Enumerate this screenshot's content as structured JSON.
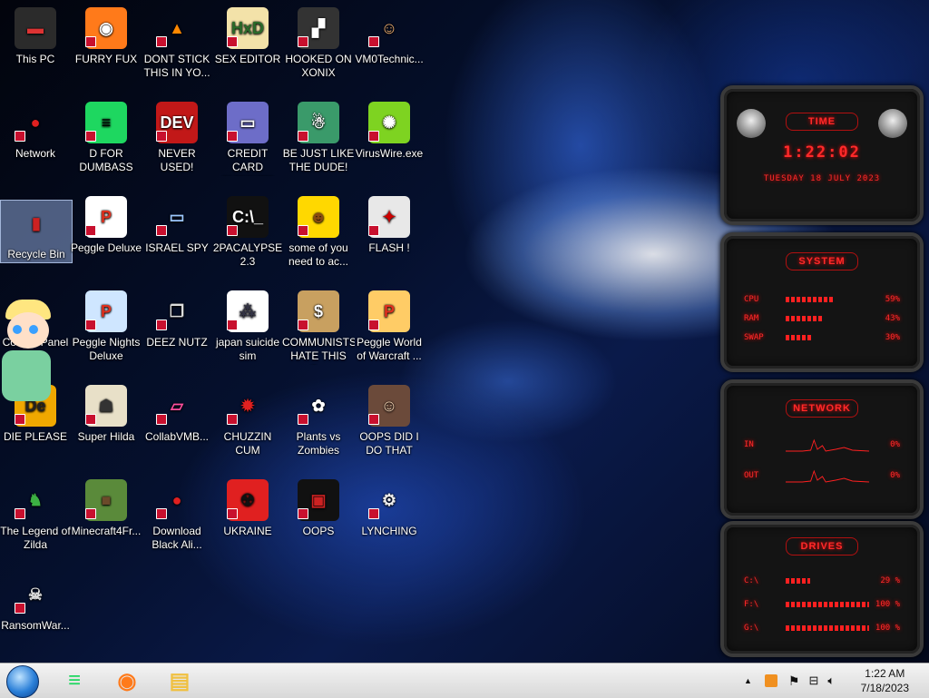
{
  "desktop_icons": [
    {
      "label": "This PC",
      "glyph": "▬",
      "bg": "#2b2b2b",
      "fg": "#d33"
    },
    {
      "label": "FURRY FUX",
      "glyph": "◉",
      "bg": "#ff7a1a",
      "fg": "#fff"
    },
    {
      "label": "DONT STICK THIS IN YO...",
      "glyph": "▲",
      "bg": "transparent",
      "fg": "#ff8800"
    },
    {
      "label": "SEX EDITOR",
      "glyph": "HxD",
      "bg": "#f3e2a9",
      "fg": "#2a6b2a"
    },
    {
      "label": "HOOKED ON XONIX",
      "glyph": "▞",
      "bg": "#333",
      "fg": "#fff"
    },
    {
      "label": "VM0Technic...",
      "glyph": "☺",
      "bg": "transparent",
      "fg": "#f0b070"
    },
    {
      "label": "Network",
      "glyph": "●",
      "bg": "transparent",
      "fg": "#e02020"
    },
    {
      "label": "D FOR DUMBASS",
      "glyph": "≡",
      "bg": "#1ed760",
      "fg": "#000"
    },
    {
      "label": "NEVER USED!",
      "glyph": "DEV",
      "bg": "#c21818",
      "fg": "#fff"
    },
    {
      "label": "CREDIT CARD CHECKER",
      "glyph": "▭",
      "bg": "#6d6dc8",
      "fg": "#fff"
    },
    {
      "label": "BE JUST LIKE THE DUDE!",
      "glyph": "☃",
      "bg": "#3a9a6a",
      "fg": "#fff"
    },
    {
      "label": "VirusWire.exe",
      "glyph": "✺",
      "bg": "#7ed321",
      "fg": "#fff"
    },
    {
      "label": "Recycle Bin",
      "glyph": "▮",
      "bg": "transparent",
      "fg": "#c22",
      "selected": true
    },
    {
      "label": "Peggle Deluxe",
      "glyph": "P",
      "bg": "#ffffff",
      "fg": "#e0301e"
    },
    {
      "label": "ISRAEL SPY",
      "glyph": "▭",
      "bg": "transparent",
      "fg": "#9cc7ff"
    },
    {
      "label": "2PACALYPSE 2.3",
      "glyph": "C:\\_",
      "bg": "#111",
      "fg": "#fff"
    },
    {
      "label": "some of you need to ac...",
      "glyph": "☻",
      "bg": "#ffd800",
      "fg": "#8a4a10"
    },
    {
      "label": "FLASH !",
      "glyph": "✦",
      "bg": "#e8e8e8",
      "fg": "#c00"
    },
    {
      "label": "Control Panel",
      "glyph": "★",
      "bg": "transparent",
      "fg": "#ffd84a"
    },
    {
      "label": "Peggle Nights Deluxe",
      "glyph": "P",
      "bg": "#cfe6ff",
      "fg": "#e0301e"
    },
    {
      "label": "DEEZ NUTZ",
      "glyph": "❐",
      "bg": "transparent",
      "fg": "#ddd"
    },
    {
      "label": "japan suicide sim",
      "glyph": "⁂",
      "bg": "#ffffff",
      "fg": "#334"
    },
    {
      "label": "COMMUNISTS HATE THIS G...",
      "glyph": "$",
      "bg": "#c8a060",
      "fg": "#fff"
    },
    {
      "label": "Peggle World of Warcraft ...",
      "glyph": "P",
      "bg": "#ffcc66",
      "fg": "#e0301e"
    },
    {
      "label": "DIE PLEASE",
      "glyph": "De",
      "bg": "#f0a800",
      "fg": "#222"
    },
    {
      "label": "Super Hilda",
      "glyph": "☗",
      "bg": "#e8e0c8",
      "fg": "#333"
    },
    {
      "label": "CollabVMB...",
      "glyph": "▱",
      "bg": "transparent",
      "fg": "#ff4fa0"
    },
    {
      "label": "CHUZZIN CUM",
      "glyph": "✹",
      "bg": "transparent",
      "fg": "#e02020"
    },
    {
      "label": "Plants vs Zombies",
      "glyph": "✿",
      "bg": "transparent",
      "fg": "#fff"
    },
    {
      "label": "OOPS DID I DO THAT",
      "glyph": "☺",
      "bg": "#6b4a3a",
      "fg": "#f0d0b0"
    },
    {
      "label": "The Legend of Zilda",
      "glyph": "♞",
      "bg": "transparent",
      "fg": "#3cb043"
    },
    {
      "label": "Minecraft4Fr...",
      "glyph": "■",
      "bg": "#5a8a3a",
      "fg": "#6b4a2a"
    },
    {
      "label": "Download Black Ali...",
      "glyph": "●",
      "bg": "transparent",
      "fg": "#e02020"
    },
    {
      "label": "UKRAINE",
      "glyph": "☢",
      "bg": "#e02020",
      "fg": "#111"
    },
    {
      "label": "OOPS",
      "glyph": "▣",
      "bg": "#111",
      "fg": "#c22"
    },
    {
      "label": "LYNCHING",
      "glyph": "⚙",
      "bg": "transparent",
      "fg": "#eee"
    },
    {
      "label": "RansomWar...",
      "glyph": "☠",
      "bg": "transparent",
      "fg": "#ddd"
    }
  ],
  "widget": {
    "time_title": "TIME",
    "time": "1:22:02",
    "date": "TUESDAY 18 JULY 2023",
    "system_title": "SYSTEM",
    "system_rows": [
      {
        "name": "CPU",
        "value": "59%",
        "fill": 0.59
      },
      {
        "name": "RAM",
        "value": "43%",
        "fill": 0.43
      },
      {
        "name": "SWAP",
        "value": "30%",
        "fill": 0.3
      }
    ],
    "network_title": "NETWORK",
    "network_rows": [
      {
        "name": "IN",
        "value": "0%"
      },
      {
        "name": "OUT",
        "value": "0%"
      }
    ],
    "drives_title": "DRIVES",
    "drive_rows": [
      {
        "name": "C:\\",
        "value": "29 %",
        "fill": 0.29
      },
      {
        "name": "F:\\",
        "value": "100 %",
        "fill": 1.0
      },
      {
        "name": "G:\\",
        "value": "100 %",
        "fill": 1.0
      }
    ]
  },
  "taskbar": {
    "pinned": [
      {
        "name": "spotify-icon",
        "glyph": "≡",
        "color": "#1ed760"
      },
      {
        "name": "firefox-icon",
        "glyph": "◉",
        "color": "#ff7a1a"
      },
      {
        "name": "file-explorer-icon",
        "glyph": "▤",
        "color": "#f0c040"
      }
    ],
    "tray_arrow": "▲",
    "clock_time": "1:22 AM",
    "clock_date": "7/18/2023"
  }
}
